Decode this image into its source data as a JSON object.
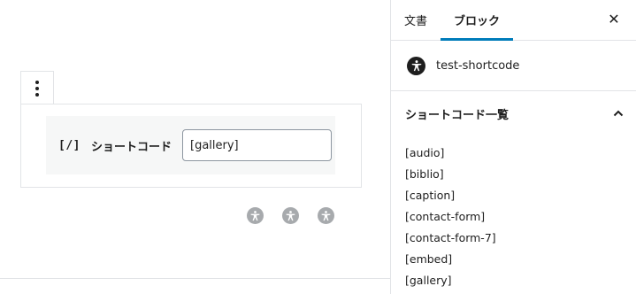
{
  "editor": {
    "shortcode_icon": "[/]",
    "shortcode_label": "ショートコード",
    "shortcode_value": "[gallery]"
  },
  "sidebar": {
    "tabs": [
      {
        "label": "文書",
        "active": false
      },
      {
        "label": "ブロック",
        "active": true
      }
    ],
    "close_label": "✕",
    "block_name": "test-shortcode",
    "panel_title": "ショートコード一覧",
    "shortcodes": [
      "[audio]",
      "[biblio]",
      "[caption]",
      "[contact-form]",
      "[contact-form-7]",
      "[embed]",
      "[gallery]"
    ]
  },
  "icons": {
    "block_menu": "more-vertical-icon",
    "block_type": "accessibility-icon",
    "collapse": "chevron-up-icon",
    "close": "close-icon"
  },
  "colors": {
    "accent": "#007cba",
    "icon_gray": "#a7aaad",
    "icon_dark": "#1e1e1e"
  }
}
